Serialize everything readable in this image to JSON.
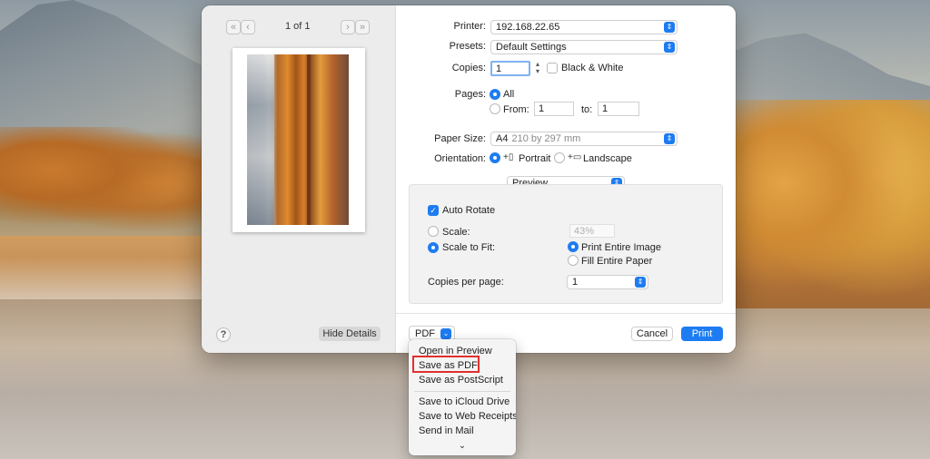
{
  "colors": {
    "accent": "#1e7cf2",
    "highlight": "#e0302e"
  },
  "left_pane": {
    "page_count": "1 of 1",
    "nav": {
      "first_icon": "double-chevron-left-icon",
      "prev_icon": "chevron-left-icon",
      "next_icon": "chevron-right-icon",
      "last_icon": "double-chevron-right-icon"
    },
    "help_label": "?",
    "hide_details_label": "Hide Details"
  },
  "form": {
    "printer": {
      "label": "Printer:",
      "value": "192.168.22.65"
    },
    "presets": {
      "label": "Presets:",
      "value": "Default Settings"
    },
    "copies": {
      "label": "Copies:",
      "value": "1",
      "bw_label": "Black & White"
    },
    "pages": {
      "label": "Pages:",
      "all_label": "All",
      "from_label": "From:",
      "from_value": "1",
      "to_label": "to:",
      "to_value": "1"
    },
    "paper_size": {
      "label": "Paper Size:",
      "value": "A4",
      "detail": "210 by 297 mm"
    },
    "orientation": {
      "label": "Orientation:",
      "portrait_label": "Portrait",
      "landscape_label": "Landscape"
    }
  },
  "preview_section": {
    "selected": "Preview",
    "auto_rotate_label": "Auto Rotate",
    "scale_label": "Scale:",
    "scale_value": "43%",
    "scale_to_fit_label": "Scale to Fit:",
    "print_entire_image_label": "Print Entire Image",
    "fill_entire_paper_label": "Fill Entire Paper",
    "copies_per_page_label": "Copies per page:",
    "copies_per_page_value": "1"
  },
  "footer": {
    "pdf_label": "PDF",
    "cancel_label": "Cancel",
    "print_label": "Print"
  },
  "pdf_menu": {
    "items": [
      "Open in Preview",
      "Save as PDF",
      "Save as PostScript",
      "Save to iCloud Drive",
      "Save to Web Receipts",
      "Send in Mail"
    ],
    "highlighted": "Save as PDF",
    "more_icon": "chevron-down-icon"
  }
}
